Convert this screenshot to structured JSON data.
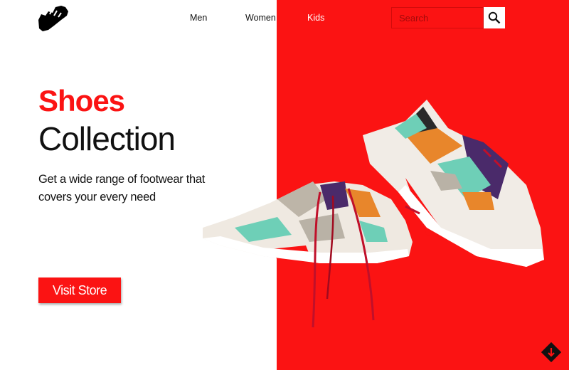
{
  "nav": {
    "items": [
      {
        "label": "Men"
      },
      {
        "label": "Women"
      },
      {
        "label": "Kids"
      }
    ]
  },
  "search": {
    "placeholder": "Search",
    "icon": "search-icon"
  },
  "hero": {
    "title_accent": "Shoes",
    "title_main": "Collection",
    "subtitle": "Get a wide range of footwear that covers your every need",
    "cta_label": "Visit Store"
  },
  "icons": {
    "logo": "shoe-logo-icon",
    "scroll": "scroll-down-icon"
  },
  "colors": {
    "accent": "#fb1313",
    "text": "#111111",
    "background": "#ffffff"
  }
}
